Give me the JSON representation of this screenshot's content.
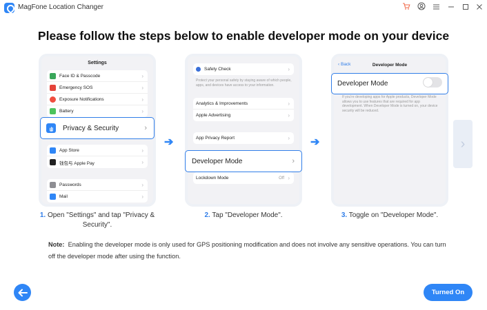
{
  "window": {
    "title": "MagFone Location Changer",
    "controls": [
      "cart-icon",
      "account-icon",
      "menu-icon",
      "minimize-icon",
      "maximize-icon",
      "close-icon"
    ]
  },
  "heading": "Please follow the steps below to enable developer mode on your device",
  "phone1": {
    "header": "Settings",
    "rows_a": [
      {
        "label": "Face ID & Passcode",
        "color": "#3aa75a"
      },
      {
        "label": "Emergency SOS",
        "color": "#e5433a"
      },
      {
        "label": "Exposure Notifications",
        "color": "#f04e3f"
      },
      {
        "label": "Battery",
        "color": "#4cc35c"
      }
    ],
    "highlight": "Privacy & Security",
    "rows_b": [
      {
        "label": "App Store",
        "color": "#2f86f6"
      },
      {
        "label": "钱包与 Apple Pay",
        "color": "#222222"
      }
    ],
    "rows_c": [
      {
        "label": "Passwords",
        "color": "#8e8e93"
      },
      {
        "label": "Mail",
        "color": "#2f86f6"
      }
    ]
  },
  "phone2": {
    "safety_check": "Safety Check",
    "safety_desc": "Protect your personal safety by staying aware of which people, apps, and devices have access to your information.",
    "rows_a": [
      "Analytics & Improvements",
      "Apple Advertising"
    ],
    "rows_b": [
      "App Privacy Report"
    ],
    "highlight": "Developer Mode",
    "lockdown": "Lockdown Mode",
    "lockdown_value": "Off"
  },
  "phone3": {
    "back": "Back",
    "header": "Developer Mode",
    "highlight": "Developer Mode",
    "desc": "If you're developing apps for Apple products, Developer Mode allows you to use features that are required for app development. When Developer Mode is turned on, your device security will be reduced."
  },
  "steps": [
    {
      "num": "1.",
      "text": "Open \"Settings\" and tap \"Privacy &",
      "text2": "Security\"."
    },
    {
      "num": "2.",
      "text": "Tap \"Developer Mode\"."
    },
    {
      "num": "3.",
      "text": "Toggle on \"Developer Mode\"."
    }
  ],
  "note": {
    "label": "Note:",
    "text": "Enabling the developer mode is only used for GPS positioning modification and does not involve any sensitive operations. You can turn off the developer mode after using the function."
  },
  "buttons": {
    "turned_on": "Turned On"
  },
  "colors": {
    "accent": "#2f86f6",
    "highlight_border": "#2f7de8"
  }
}
